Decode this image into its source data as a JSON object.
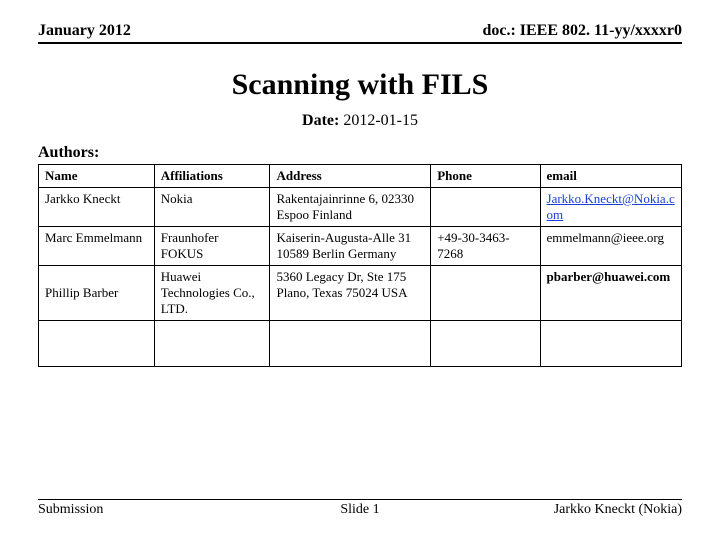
{
  "header": {
    "left": "January 2012",
    "right": "doc.: IEEE 802. 11-yy/xxxxr0"
  },
  "title": "Scanning with FILS",
  "date_label": "Date:",
  "date_value": "2012-01-15",
  "authors_label": "Authors:",
  "columns": {
    "name": "Name",
    "affiliations": "Affiliations",
    "address": "Address",
    "phone": "Phone",
    "email": "email"
  },
  "authors": [
    {
      "name": "Jarkko Kneckt",
      "affiliations": "Nokia",
      "address": "Rakentajainrinne 6, 02330 Espoo Finland",
      "phone": "",
      "email": "Jarkko.Kneckt@Nokia.com"
    },
    {
      "name": "Marc Emmelmann",
      "affiliations": "Fraunhofer FOKUS",
      "address": "Kaiserin-Augusta-Alle 31 10589 Berlin Germany",
      "phone": "+49-30-3463-7268",
      "email": "emmelmann@ieee.org"
    },
    {
      "name": "Phillip Barber",
      "affiliations": "Huawei Technologies Co., LTD.",
      "address": "5360 Legacy Dr, Ste 175\nPlano, Texas 75024 USA",
      "phone": "",
      "email": "pbarber@huawei.com"
    }
  ],
  "footer": {
    "left": "Submission",
    "center": "Slide 1",
    "right": "Jarkko Kneckt (Nokia)"
  }
}
